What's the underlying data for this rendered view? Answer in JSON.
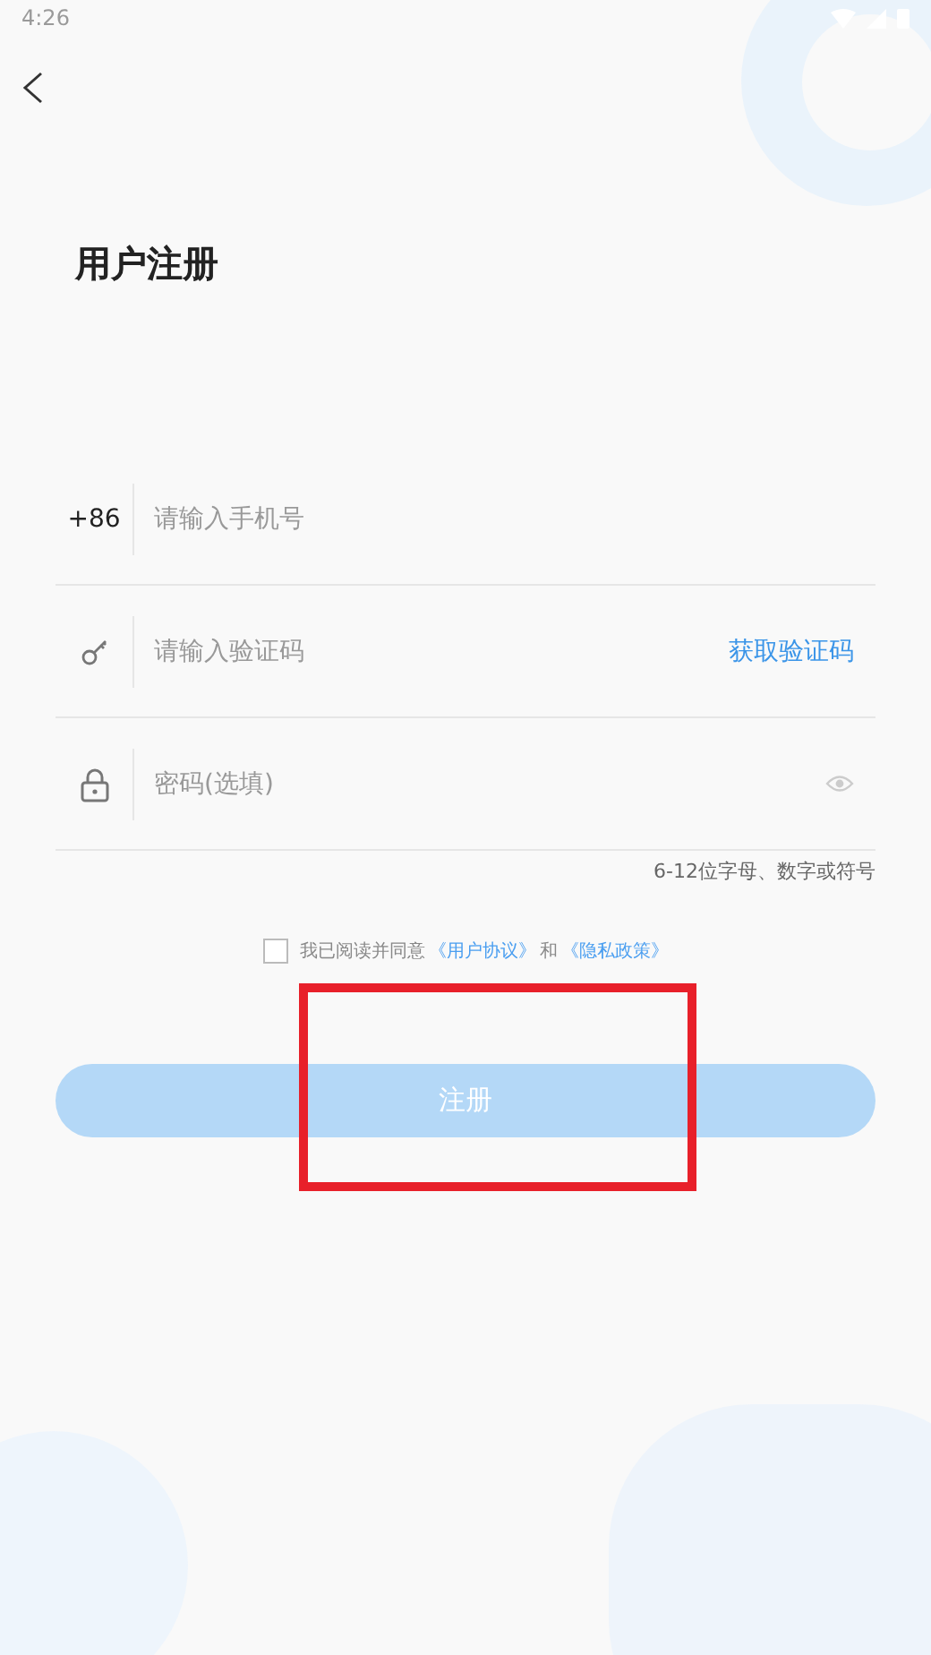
{
  "status_bar": {
    "time": "4:26"
  },
  "title": "用户注册",
  "fields": [
    {
      "kind": "phone",
      "prefix": "+86",
      "placeholder": "请输入手机号"
    },
    {
      "kind": "code",
      "placeholder": "请输入验证码",
      "action": "获取验证码"
    },
    {
      "kind": "password",
      "placeholder": "密码(选填)"
    }
  ],
  "password_hint": "6-12位字母、数字或符号",
  "agreement": {
    "checked": false,
    "text": "我已阅读并同意",
    "links": [
      "《用户协议》",
      "《隐私政策》"
    ],
    "joiner": "和"
  },
  "submit": {
    "label": "注册",
    "disabled": true
  }
}
